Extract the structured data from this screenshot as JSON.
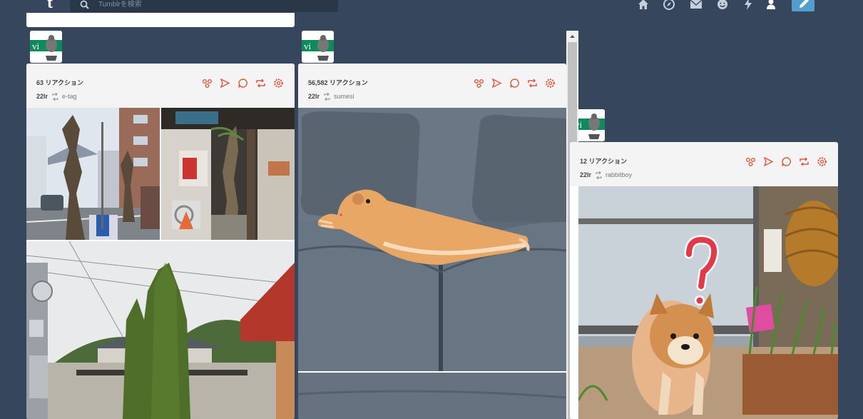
{
  "colors": {
    "background": "#36465d",
    "accent": "#e0563c",
    "compose": "#529ecc"
  },
  "header": {
    "logo": "t",
    "search_placeholder": "Tumblrを検索",
    "nav_icons": [
      "home-icon",
      "explore-icon",
      "mail-icon",
      "activity-smiley-icon",
      "lightning-icon",
      "account-icon",
      "compose-pencil-icon"
    ]
  },
  "avatar_text": "vi",
  "posts": [
    {
      "notes": "63 リアクション",
      "via": "22lr",
      "source": "e-tag"
    },
    {
      "notes": "56,582 リアクション",
      "via": "22lr",
      "source": "sumesi"
    },
    {
      "notes": "12 リアクション",
      "via": "22lr",
      "source": "rabbitboy"
    }
  ]
}
